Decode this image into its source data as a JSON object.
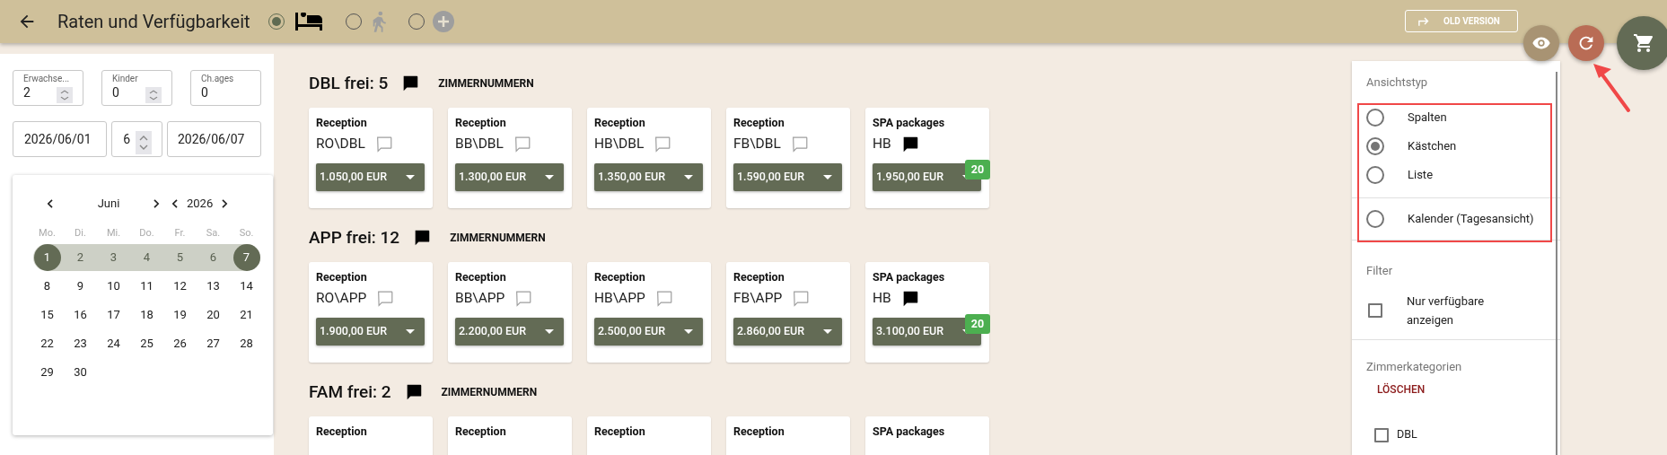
{
  "header": {
    "title": "Raten und Verfügbarkeit",
    "modes": [
      {
        "kind": "bed",
        "selected": true,
        "disabled": false
      },
      {
        "kind": "walk",
        "selected": false,
        "disabled": true
      },
      {
        "kind": "plus",
        "selected": false,
        "disabled": true
      }
    ],
    "old_version_button": "OLD VERSION"
  },
  "booking": {
    "fields": [
      {
        "label": "Erwachse...",
        "value": "2",
        "spinner": true
      },
      {
        "label": "Kinder",
        "value": "0",
        "spinner": true
      },
      {
        "label": "Ch.ages",
        "value": "0",
        "spinner": false
      }
    ],
    "arrival": "2026/06/01",
    "nights": "6",
    "departure": "2026/06/07"
  },
  "calendar": {
    "month": "Juni",
    "year": "2026",
    "weekdays": [
      "Mo.",
      "Di.",
      "Mi.",
      "Do.",
      "Fr.",
      "Sa.",
      "So."
    ],
    "weeks": [
      [
        {
          "day": "1",
          "selected": true,
          "in_range": true
        },
        {
          "day": "2",
          "selected": false,
          "in_range": true
        },
        {
          "day": "3",
          "selected": false,
          "in_range": true
        },
        {
          "day": "4",
          "selected": false,
          "in_range": true
        },
        {
          "day": "5",
          "selected": false,
          "in_range": true
        },
        {
          "day": "6",
          "selected": false,
          "in_range": true
        },
        {
          "day": "7",
          "selected": true,
          "in_range": true
        }
      ],
      [
        {
          "day": "8",
          "selected": false,
          "in_range": false
        },
        {
          "day": "9",
          "selected": false,
          "in_range": false
        },
        {
          "day": "10",
          "selected": false,
          "in_range": false
        },
        {
          "day": "11",
          "selected": false,
          "in_range": false
        },
        {
          "day": "12",
          "selected": false,
          "in_range": false
        },
        {
          "day": "13",
          "selected": false,
          "in_range": false
        },
        {
          "day": "14",
          "selected": false,
          "in_range": false
        }
      ],
      [
        {
          "day": "15",
          "selected": false,
          "in_range": false
        },
        {
          "day": "16",
          "selected": false,
          "in_range": false
        },
        {
          "day": "17",
          "selected": false,
          "in_range": false
        },
        {
          "day": "18",
          "selected": false,
          "in_range": false
        },
        {
          "day": "19",
          "selected": false,
          "in_range": false
        },
        {
          "day": "20",
          "selected": false,
          "in_range": false
        },
        {
          "day": "21",
          "selected": false,
          "in_range": false
        }
      ],
      [
        {
          "day": "22",
          "selected": false,
          "in_range": false
        },
        {
          "day": "23",
          "selected": false,
          "in_range": false
        },
        {
          "day": "24",
          "selected": false,
          "in_range": false
        },
        {
          "day": "25",
          "selected": false,
          "in_range": false
        },
        {
          "day": "26",
          "selected": false,
          "in_range": false
        },
        {
          "day": "27",
          "selected": false,
          "in_range": false
        },
        {
          "day": "28",
          "selected": false,
          "in_range": false
        }
      ],
      [
        {
          "day": "29",
          "selected": false,
          "in_range": false
        },
        {
          "day": "30",
          "selected": false,
          "in_range": false
        }
      ]
    ]
  },
  "sections": [
    {
      "title": "DBL frei: 5",
      "rooms_link": "ZIMMERNUMMERN",
      "cards": [
        {
          "source": "Reception",
          "rate": "RO\\DBL",
          "comment": false,
          "price": "1.050,00 EUR"
        },
        {
          "source": "Reception",
          "rate": "BB\\DBL",
          "comment": false,
          "price": "1.300,00 EUR"
        },
        {
          "source": "Reception",
          "rate": "HB\\DBL",
          "comment": false,
          "price": "1.350,00 EUR"
        },
        {
          "source": "Reception",
          "rate": "FB\\DBL",
          "comment": false,
          "price": "1.590,00 EUR"
        },
        {
          "source": "SPA packages",
          "rate": "HB",
          "comment": true,
          "price": "1.950,00 EUR",
          "badge": "20"
        }
      ]
    },
    {
      "title": "APP frei: 12",
      "rooms_link": "ZIMMERNUMMERN",
      "cards": [
        {
          "source": "Reception",
          "rate": "RO\\APP",
          "comment": false,
          "price": "1.900,00 EUR"
        },
        {
          "source": "Reception",
          "rate": "BB\\APP",
          "comment": false,
          "price": "2.200,00 EUR"
        },
        {
          "source": "Reception",
          "rate": "HB\\APP",
          "comment": false,
          "price": "2.500,00 EUR"
        },
        {
          "source": "Reception",
          "rate": "FB\\APP",
          "comment": false,
          "price": "2.860,00 EUR"
        },
        {
          "source": "SPA packages",
          "rate": "HB",
          "comment": true,
          "price": "3.100,00 EUR",
          "badge": "20"
        }
      ]
    },
    {
      "title": "FAM frei: 2",
      "rooms_link": "ZIMMERNUMMERN",
      "cards": [
        {
          "source": "Reception"
        },
        {
          "source": "Reception"
        },
        {
          "source": "Reception"
        },
        {
          "source": "Reception"
        },
        {
          "source": "SPA packages"
        }
      ]
    }
  ],
  "view_panel": {
    "title": "Ansichtstyp",
    "options": [
      {
        "label": "Spalten",
        "selected": false,
        "kind": "radio"
      },
      {
        "label": "Kästchen",
        "selected": true,
        "kind": "radio"
      },
      {
        "label": "Liste",
        "selected": false,
        "kind": "radio"
      },
      {
        "label": "Kalender (Tagesansicht)",
        "selected": false,
        "kind": "separated"
      }
    ],
    "filter_title": "Filter",
    "filters": [
      {
        "label": "Nur verfügbare anzeigen",
        "checked": false
      }
    ],
    "categories_title": "Zimmerkategorien",
    "clear_button": "LÖSCHEN",
    "categories": [
      {
        "label": "DBL",
        "checked": false
      }
    ]
  }
}
